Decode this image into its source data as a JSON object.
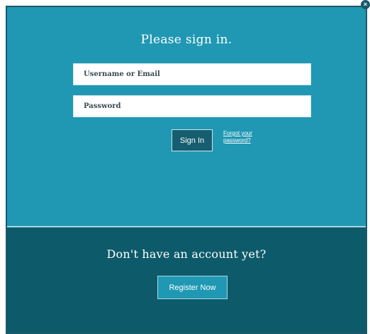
{
  "signin": {
    "title": "Please sign in.",
    "username_placeholder": "Username or Email",
    "password_placeholder": "Password",
    "signin_label": "Sign In",
    "forgot_label": "Forgot your password?"
  },
  "register": {
    "title": "Don't have an account yet?",
    "button_label": "Register Now"
  },
  "close": {
    "icon": "close-icon",
    "glyph": "×"
  },
  "colors": {
    "top_panel": "#2098b3",
    "bottom_panel": "#0d5a6a",
    "signin_button": "#165d70"
  }
}
